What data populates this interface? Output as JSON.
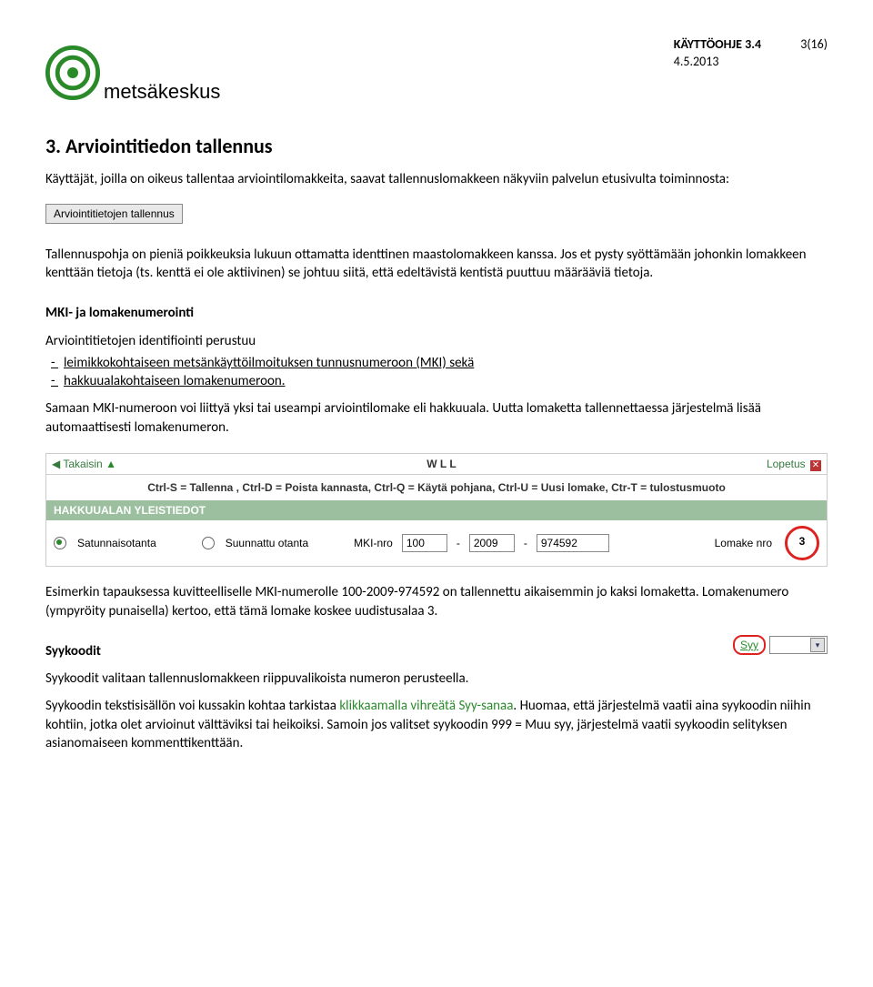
{
  "header": {
    "doc_title": "KÄYTTÖOHJE 3.4",
    "page_num": "3(16)",
    "date": "4.5.2013",
    "brand": "metsäkeskus"
  },
  "section": {
    "heading": "3. Arviointitiedon tallennus",
    "intro": "Käyttäjät, joilla on oikeus tallentaa arviointilomakkeita, saavat tallennuslomakkeen näkyviin palvelun etusivulta toiminnosta:",
    "btn_label": "Arviointitietojen tallennus",
    "para2": "Tallennuspohja on pieniä poikkeuksia lukuun ottamatta identtinen maastolomakkeen kanssa. Jos et pysty syöttämään johonkin lomakkeen kenttään tietoja (ts. kenttä ei ole aktiivinen) se johtuu siitä, että edeltävistä kentistä puuttuu määrääviä tietoja."
  },
  "mki": {
    "subhead": "MKI- ja lomakenumerointi",
    "line1": "Arviointitietojen identifiointi perustuu",
    "bullets": [
      "leimikkokohtaiseen metsänkäyttöilmoituksen tunnusnumeroon (MKI) sekä",
      "hakkuualakohtaiseen lomakenumeroon."
    ],
    "para": "Samaan MKI-numeroon voi liittyä yksi tai useampi arviointilomake eli hakkuuala. Uutta lomaketta tallennettaessa järjestelmä lisää automaattisesti lomakenumeron."
  },
  "ui1": {
    "back": "Takaisin",
    "center": "W L L",
    "end": "Lopetus",
    "shortcuts": "Ctrl-S = Tallenna , Ctrl-D = Poista kannasta, Ctrl-Q = Käytä pohjana, Ctrl-U = Uusi lomake, Ctr-T = tulostusmuoto",
    "sectionbar": "HAKKUUALAN YLEISTIEDOT",
    "radio1": "Satunnaisotanta",
    "radio2": "Suunnattu otanta",
    "mki_label": "MKI-nro",
    "mki1": "100",
    "mki2": "2009",
    "mki3": "974592",
    "lomake_label": "Lomake nro",
    "lomake_val": "3"
  },
  "example": {
    "para": "Esimerkin tapauksessa kuvitteelliselle MKI-numerolle 100-2009-974592 on tallennettu aikaisemmin jo kaksi lomaketta. Lomakenumero (ympyröity punaisella) kertoo, että tämä lomake koskee uudistusalaa 3."
  },
  "syy": {
    "subhead": "Syykoodit",
    "line1": "Syykoodit valitaan tallennuslomakkeen riippuvalikoista numeron perusteella.",
    "line2a": "Syykoodin tekstisisällön voi kussakin kohtaa tarkistaa ",
    "line2b": "klikkaamalla vihreätä Syy-sanaa",
    "line2c": ". Huomaa, että järjestelmä vaatii aina syykoodin niihin kohtiin, jotka olet arvioinut välttäviksi tai heikoiksi. Samoin jos valitset syykoodin 999 = Muu syy, järjestelmä vaatii syykoodin selityksen asianomaiseen kommenttikenttään.",
    "dropdown_label": "Syy"
  }
}
